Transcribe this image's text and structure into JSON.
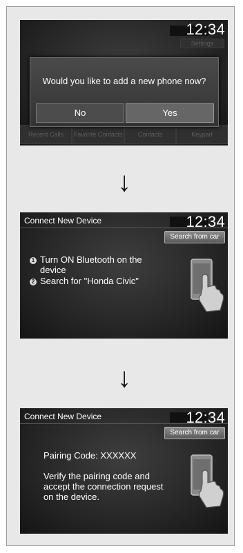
{
  "screen1": {
    "clock": "12:34",
    "settings_label": "Settings",
    "dialog_text": "Would you like to add a new phone now?",
    "no_label": "No",
    "yes_label": "Yes",
    "bottom_buttons": [
      "Recent Calls",
      "Favorite Contacts",
      "Contacts",
      "Keypad"
    ]
  },
  "screen2": {
    "title": "Connect New Device",
    "clock": "12:34",
    "search_label": "Search from car",
    "step1_num": "1",
    "step1_line1": "Turn ON Bluetooth on the",
    "step1_line2": "device",
    "step2_num": "2",
    "step2_text": "Search for \"Honda Civic\""
  },
  "screen3": {
    "title": "Connect New Device",
    "clock": "12:34",
    "search_label": "Search from car",
    "pairing_code": "Pairing Code: XXXXXX",
    "verify_line1": "Verify the pairing code and",
    "verify_line2": "accept the connection request",
    "verify_line3": "on the device."
  },
  "arrows": [
    "↓",
    "↓"
  ],
  "colors": {
    "screen_bg": "#262626",
    "yes_button": "#5a5a5a",
    "no_button": "#4a4a4a",
    "panel_bg": "#e8e8e8"
  }
}
